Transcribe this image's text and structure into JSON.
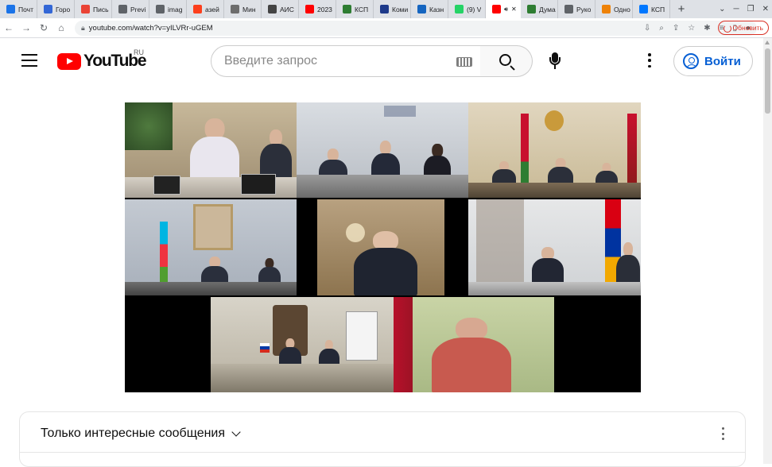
{
  "browser": {
    "tabs": [
      {
        "title": "Почт",
        "icon": "mail-icon",
        "color": "#1a73e8"
      },
      {
        "title": "Горо",
        "icon": "news-icon",
        "color": "#3367d6"
      },
      {
        "title": "Пись",
        "icon": "mail-icon",
        "color": "#ea4335"
      },
      {
        "title": "Previ",
        "icon": "globe-icon",
        "color": "#5f6368"
      },
      {
        "title": "imag",
        "icon": "globe-icon",
        "color": "#5f6368"
      },
      {
        "title": "азей",
        "icon": "yandex-icon",
        "color": "#fc3f1d"
      },
      {
        "title": "Мин",
        "icon": "emblem-icon",
        "color": "#6d6d6d"
      },
      {
        "title": "АИС",
        "icon": "emblem-icon",
        "color": "#444444"
      },
      {
        "title": "2023",
        "icon": "youtube-icon",
        "color": "#ff0000"
      },
      {
        "title": "КСП",
        "icon": "site-icon",
        "color": "#2e7d32"
      },
      {
        "title": "Коми",
        "icon": "site-icon",
        "color": "#1e3a8a"
      },
      {
        "title": "Казн",
        "icon": "site-icon",
        "color": "#1565c0"
      },
      {
        "title": "(9) V",
        "icon": "whatsapp-icon",
        "color": "#25d366"
      },
      {
        "title": "",
        "icon": "youtube-icon",
        "color": "#ff0000",
        "active": true
      },
      {
        "title": "Дума",
        "icon": "site-icon",
        "color": "#2e7d32"
      },
      {
        "title": "Руко",
        "icon": "site-icon",
        "color": "#5f6368"
      },
      {
        "title": "Одно",
        "icon": "ok-icon",
        "color": "#ee8208"
      },
      {
        "title": "КСП",
        "icon": "vk-icon",
        "color": "#0077ff"
      }
    ],
    "url": "youtube.com/watch?v=yILVRr-uGEM",
    "update_button": "Обновить"
  },
  "youtube": {
    "logo_text": "YouTube",
    "country_code": "RU",
    "search_placeholder": "Введите запрос",
    "sign_in": "Войти"
  },
  "video": {
    "tiles": 8
  },
  "chat": {
    "mode_label": "Только интересные сообщения"
  }
}
